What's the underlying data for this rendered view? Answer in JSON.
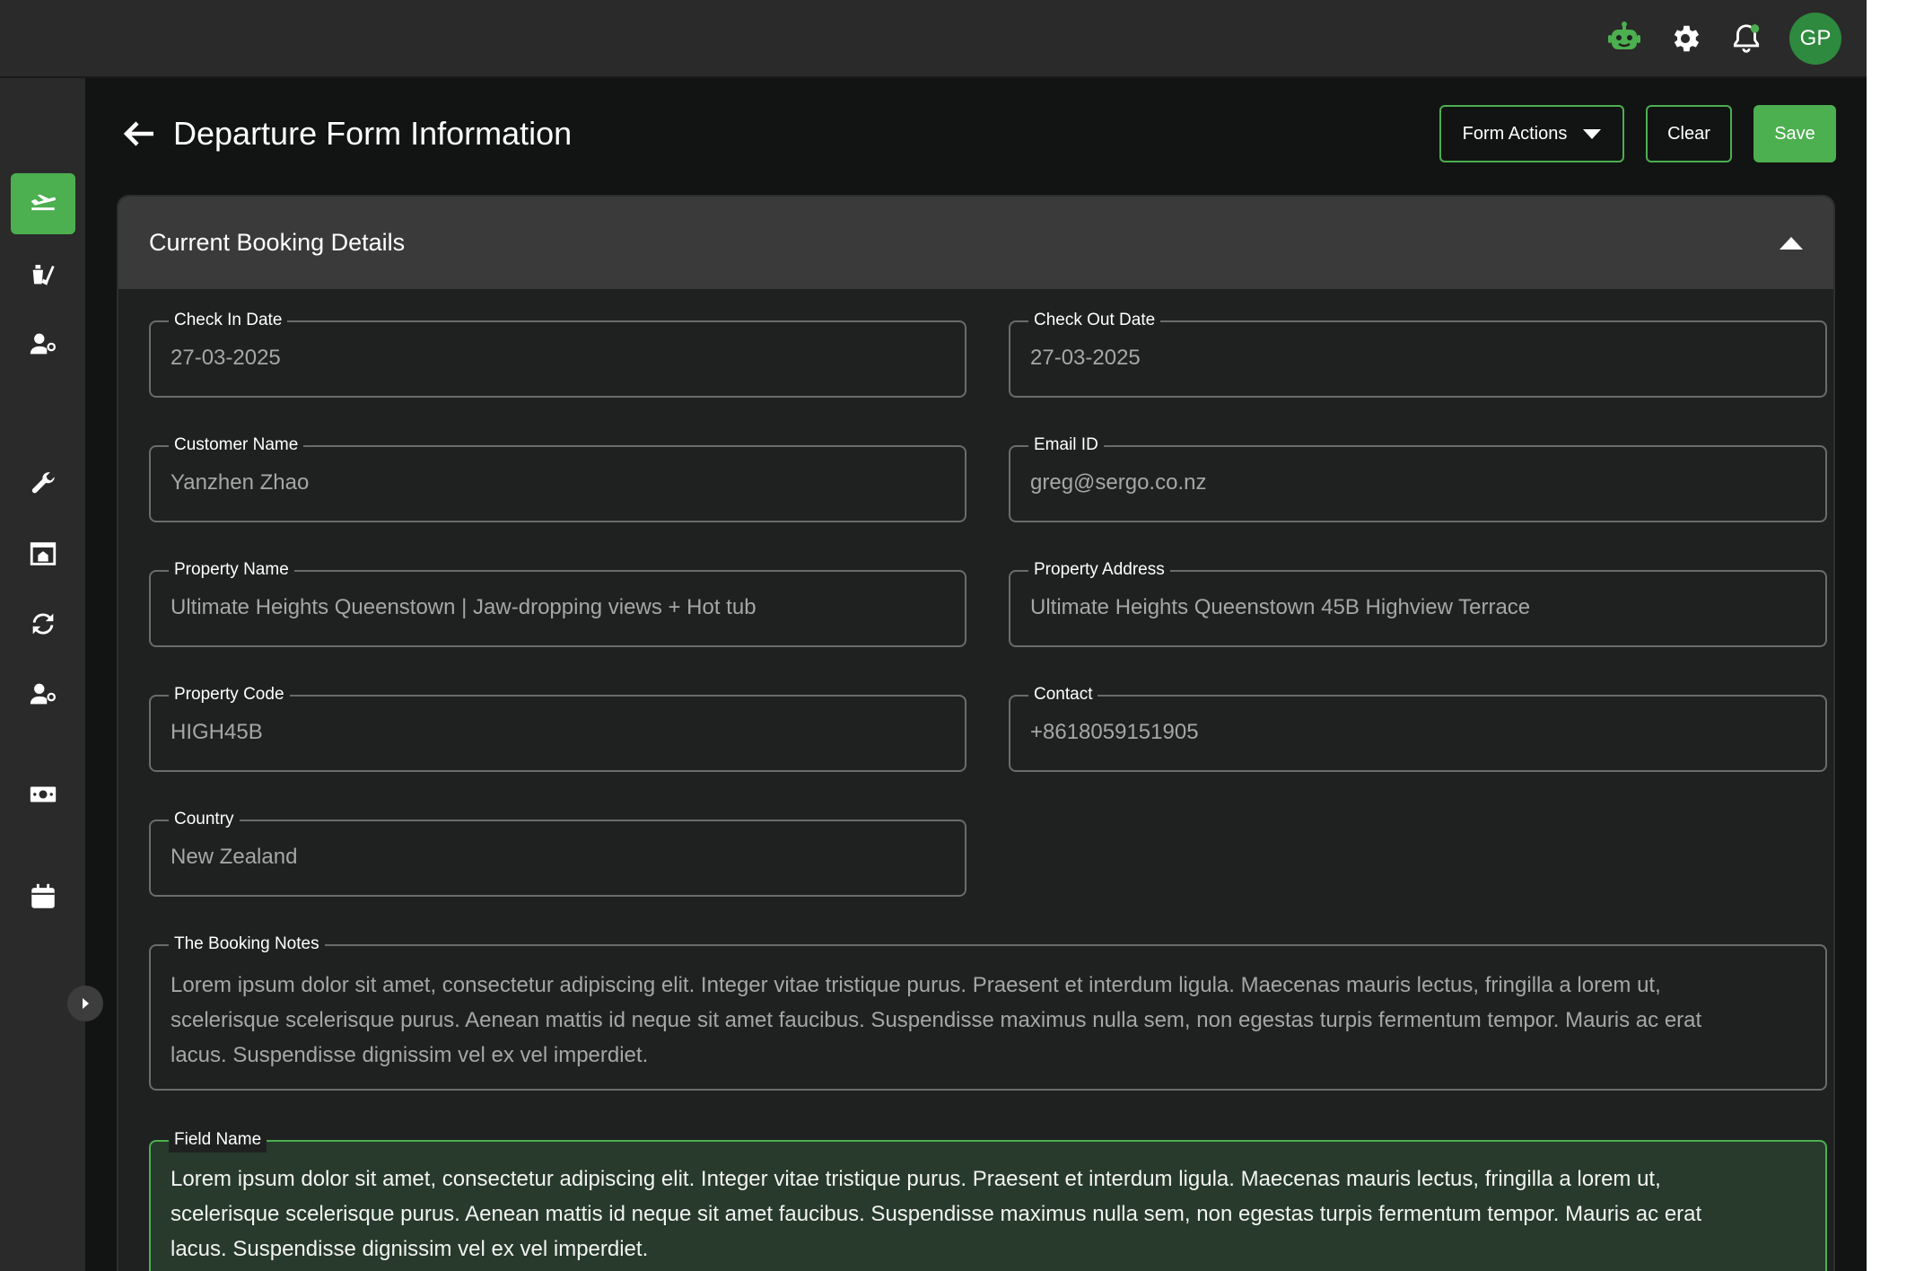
{
  "header": {
    "title": "Departure Form Information",
    "avatar_initials": "GP",
    "icons": [
      "bot-icon",
      "gear-icon",
      "bell-icon"
    ]
  },
  "actions": {
    "form_actions_label": "Form Actions",
    "clear_label": "Clear",
    "save_label": "Save"
  },
  "sidebar": {
    "items": [
      {
        "icon": "departure-plane-icon",
        "active": true
      },
      {
        "icon": "cleaning-icon",
        "active": false
      },
      {
        "icon": "user-settings-icon",
        "active": false
      },
      {
        "icon": "wrench-icon",
        "active": false
      },
      {
        "icon": "property-icon",
        "active": false
      },
      {
        "icon": "sync-icon",
        "active": false
      },
      {
        "icon": "user-settings-icon",
        "active": false
      },
      {
        "icon": "cash-icon",
        "active": false
      },
      {
        "icon": "calendar-icon",
        "active": false
      }
    ]
  },
  "card": {
    "title": "Current Booking Details"
  },
  "fields": {
    "check_in_date": {
      "label": "Check In Date",
      "value": "27-03-2025"
    },
    "check_out_date": {
      "label": "Check Out Date",
      "value": "27-03-2025"
    },
    "customer_name": {
      "label": "Customer Name",
      "value": "Yanzhen Zhao"
    },
    "email_id": {
      "label": "Email ID",
      "value": "greg@sergo.co.nz"
    },
    "property_name": {
      "label": "Property Name",
      "value": "Ultimate Heights Queenstown | Jaw-dropping views + Hot tub"
    },
    "property_address": {
      "label": "Property Address",
      "value": "Ultimate Heights Queenstown 45B Highview Terrace"
    },
    "property_code": {
      "label": "Property Code",
      "value": "HIGH45B"
    },
    "contact": {
      "label": "Contact",
      "value": "+8618059151905"
    },
    "country": {
      "label": "Country",
      "value": "New Zealand"
    },
    "booking_notes": {
      "label": "The Booking Notes",
      "value": "Lorem ipsum dolor sit amet, consectetur adipiscing elit. Integer vitae tristique purus. Praesent et interdum ligula. Maecenas mauris lectus, fringilla a lorem ut, scelerisque scelerisque purus. Aenean mattis id neque sit amet faucibus. Suspendisse maximus nulla sem, non egestas turpis fermentum tempor. Mauris ac erat lacus. Suspendisse dignissim vel ex vel imperdiet."
    },
    "field_name": {
      "label": "Field Name",
      "value": "Lorem ipsum dolor sit amet, consectetur adipiscing elit. Integer vitae tristique purus. Praesent et interdum ligula. Maecenas mauris lectus, fringilla a lorem ut, scelerisque scelerisque purus. Aenean mattis id neque sit amet faucibus. Suspendisse maximus nulla sem, non egestas turpis fermentum tempor. Mauris ac erat lacus. Suspendisse dignissim vel ex vel imperdiet."
    }
  },
  "colors": {
    "accent": "#4caf50",
    "background": "#121413",
    "card": "#1f2120",
    "active_field": "#273a2b"
  }
}
